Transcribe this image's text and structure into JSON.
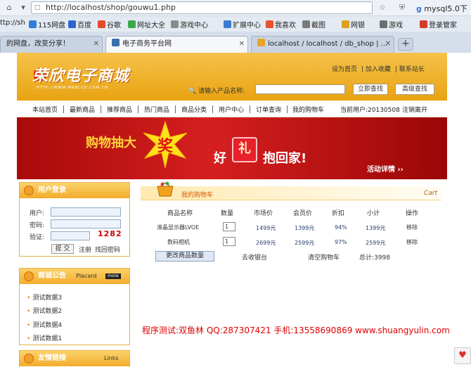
{
  "browser": {
    "url": "http://localhost/shop/gouwu1.php",
    "right_site_label": "mysql5.0下",
    "bookmarks": [
      {
        "label": "ttp://sh",
        "color": "#3b74c4"
      },
      {
        "label": "115网盘",
        "color": "#2f7ed8"
      },
      {
        "label": "百度",
        "color": "#2d62d3"
      },
      {
        "label": "谷歌",
        "color": "#e64a2e"
      },
      {
        "label": "网址大全",
        "color": "#3aa84a"
      },
      {
        "label": "游戏中心",
        "color": "#8a8a8a"
      },
      {
        "label": "扩展中心",
        "color": "#3a7bd0"
      },
      {
        "label": "我喜欢",
        "color": "#e8532d"
      },
      {
        "label": "截图",
        "color": "#7a7a7a"
      },
      {
        "label": "网银",
        "color": "#d9a21e"
      },
      {
        "label": "游戏",
        "color": "#6e6e6e"
      },
      {
        "label": "登录管家",
        "color": "#d43b2a"
      }
    ],
    "tabs": [
      {
        "label": "的网盘，改变分享！"
      },
      {
        "label": "电子商务平台网"
      },
      {
        "label": "localhost / localhost / db_shop | ..."
      }
    ],
    "new_tab": "+"
  },
  "header": {
    "logo": "荣欣电子商城",
    "logo_url": "HTTP://WWW.MRBCCD.COM.CN",
    "top_links": [
      "设为首页",
      "加入收藏",
      "联系站长"
    ],
    "search_label": "请输入产品名称:",
    "search_button": "立即查找",
    "advanced_button": "高级查找"
  },
  "menu": {
    "items": [
      "本站首页",
      "最新商品",
      "推荐商品",
      "热门商品",
      "商品分类",
      "用户中心",
      "订单查询",
      "我的购物车"
    ],
    "current_user": "当前用户:20130508",
    "logout": "注销离开"
  },
  "banner": {
    "text1": "购物抽大",
    "star_char": "奖",
    "good": "好",
    "gift_char": "礼",
    "text2": "抱回家!",
    "details": "活动详情 ››"
  },
  "login": {
    "title": "用户登录",
    "user_label": "用户:",
    "pass_label": "密码:",
    "verify_label": "验证:",
    "captcha": "1282",
    "submit": "提 交",
    "register": "注册",
    "forgot": "找回密码"
  },
  "notice": {
    "title": "商城公告",
    "en": "Placard",
    "more": "more",
    "items": [
      "测试数据3",
      "测试数据2",
      "测试数据4",
      "测试数据1"
    ]
  },
  "links_box": {
    "title": "友情链接",
    "en": "Links"
  },
  "cart": {
    "title": "我的购物车",
    "en": "Cart",
    "headers": [
      "商品名称",
      "数量",
      "市场价",
      "会员价",
      "折扣",
      "小计",
      "操作"
    ],
    "rows": [
      {
        "name": "液晶显示器LVOE",
        "qty": "1",
        "market": "1499元",
        "member": "1399元",
        "discount": "94%",
        "subtotal": "1399元",
        "action": "移除"
      },
      {
        "name": "数码相机",
        "qty": "1",
        "market": "2699元",
        "member": "2599元",
        "discount": "97%",
        "subtotal": "2599元",
        "action": "移除"
      }
    ],
    "update_button": "更改商品数量",
    "checkout": "去收银台",
    "clear": "清空购物车",
    "total": "总计:3998"
  },
  "footer_note": "程序测试:双鱼林 QQ:287307421 手机:13558690869 www.shuangyulin.com"
}
